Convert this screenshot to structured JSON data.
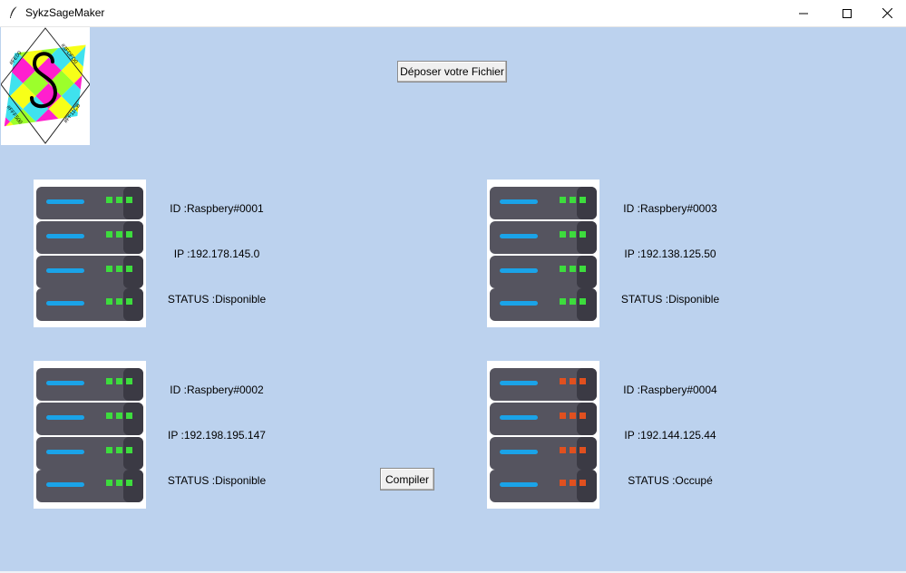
{
  "window": {
    "title": "SykzSageMaker",
    "app_icon": "feather-icon",
    "controls": [
      "minimize-icon",
      "maximize-icon",
      "close-icon"
    ]
  },
  "logo": {
    "letter": "S",
    "corner_labels": [
      "#FE00",
      "#3FDFD0",
      "#FFF500",
      "#FF11CB"
    ],
    "colors": [
      "#ff1fce",
      "#3fe2ee",
      "#f7ff18",
      "#9cff2b"
    ]
  },
  "buttons": {
    "upload": "Déposer votre Fichier",
    "compile": "Compiler"
  },
  "servers": [
    {
      "id": "ID :Raspbery#0001",
      "ip": "IP :192.178.145.0",
      "status": "STATUS :Disponible",
      "led_color": "#3ddc3d"
    },
    {
      "id": "ID :Raspbery#0002",
      "ip": "IP :192.198.195.147",
      "status": "STATUS :Disponible",
      "led_color": "#3ddc3d"
    },
    {
      "id": "ID :Raspbery#0003",
      "ip": "IP :192.138.125.50",
      "status": "STATUS :Disponible",
      "led_color": "#3ddc3d"
    },
    {
      "id": "ID :Raspbery#0004",
      "ip": "IP :192.144.125.44",
      "status": "STATUS :Occupé",
      "led_color": "#e0501f"
    }
  ],
  "colors": {
    "background": "#bcd2ee",
    "rack_body": "#55545f",
    "rack_side": "#3b3a44",
    "drive_bar": "#1aa3e8"
  }
}
